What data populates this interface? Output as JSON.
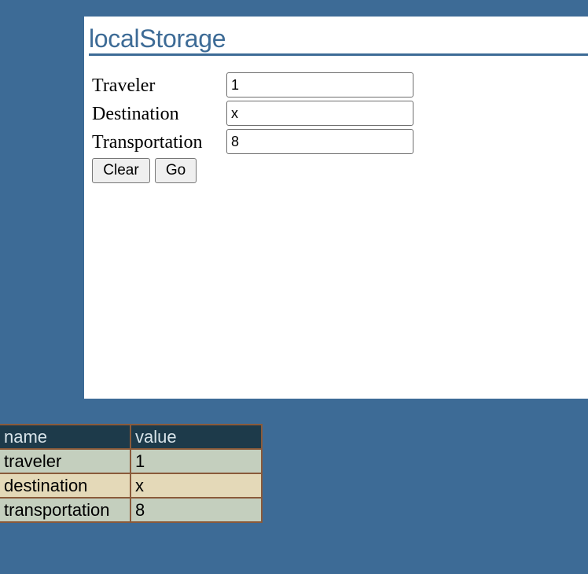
{
  "panel": {
    "title": "localStorage"
  },
  "form": {
    "fields": [
      {
        "label": "Traveler",
        "value": "1"
      },
      {
        "label": "Destination",
        "value": "x"
      },
      {
        "label": "Transportation",
        "value": "8"
      }
    ],
    "clear_label": "Clear",
    "go_label": "Go"
  },
  "storage_table": {
    "headers": [
      "name",
      "value"
    ],
    "rows": [
      [
        "traveler",
        "1"
      ],
      [
        "destination",
        "x"
      ],
      [
        "transportation",
        "8"
      ]
    ]
  },
  "colors": {
    "page_background": "#3d6b96",
    "panel_background": "#ffffff",
    "title_color": "#3d6b96",
    "table_header": "#1d3a4a",
    "table_row_odd": "#c4cfbe",
    "table_row_even": "#e4d9b8",
    "table_border": "#8a5a3a"
  }
}
